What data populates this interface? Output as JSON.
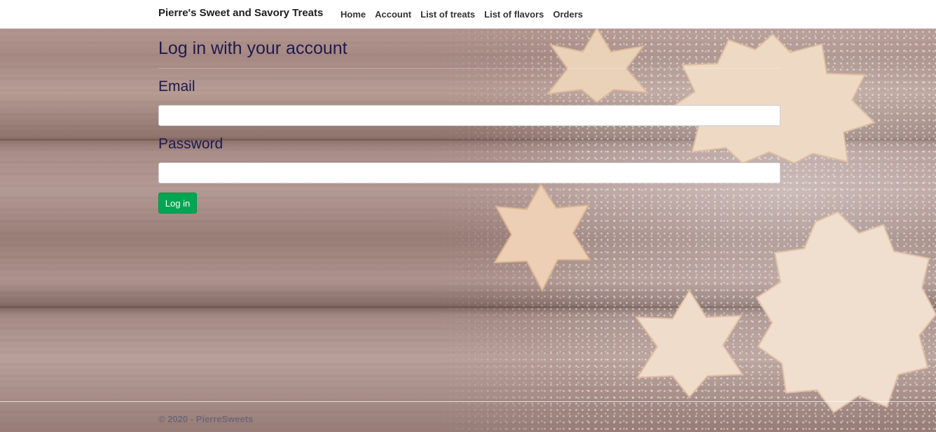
{
  "navbar": {
    "brand": "Pierre's Sweet and Savory Treats",
    "links": [
      "Home",
      "Account",
      "List of treats",
      "List of flavors",
      "Orders"
    ]
  },
  "login_form": {
    "title": "Log in with your account",
    "email_label": "Email",
    "email_value": "",
    "password_label": "Password",
    "password_value": "",
    "submit_label": "Log in"
  },
  "footer": {
    "text": "© 2020 - PierreSweets"
  },
  "colors": {
    "heading_text": "#1f1a4d",
    "button": "#00a651",
    "footer_text": "#6f6775"
  },
  "icons": {
    "background": "wood-table-with-sugar-dusted-cookies-image"
  }
}
